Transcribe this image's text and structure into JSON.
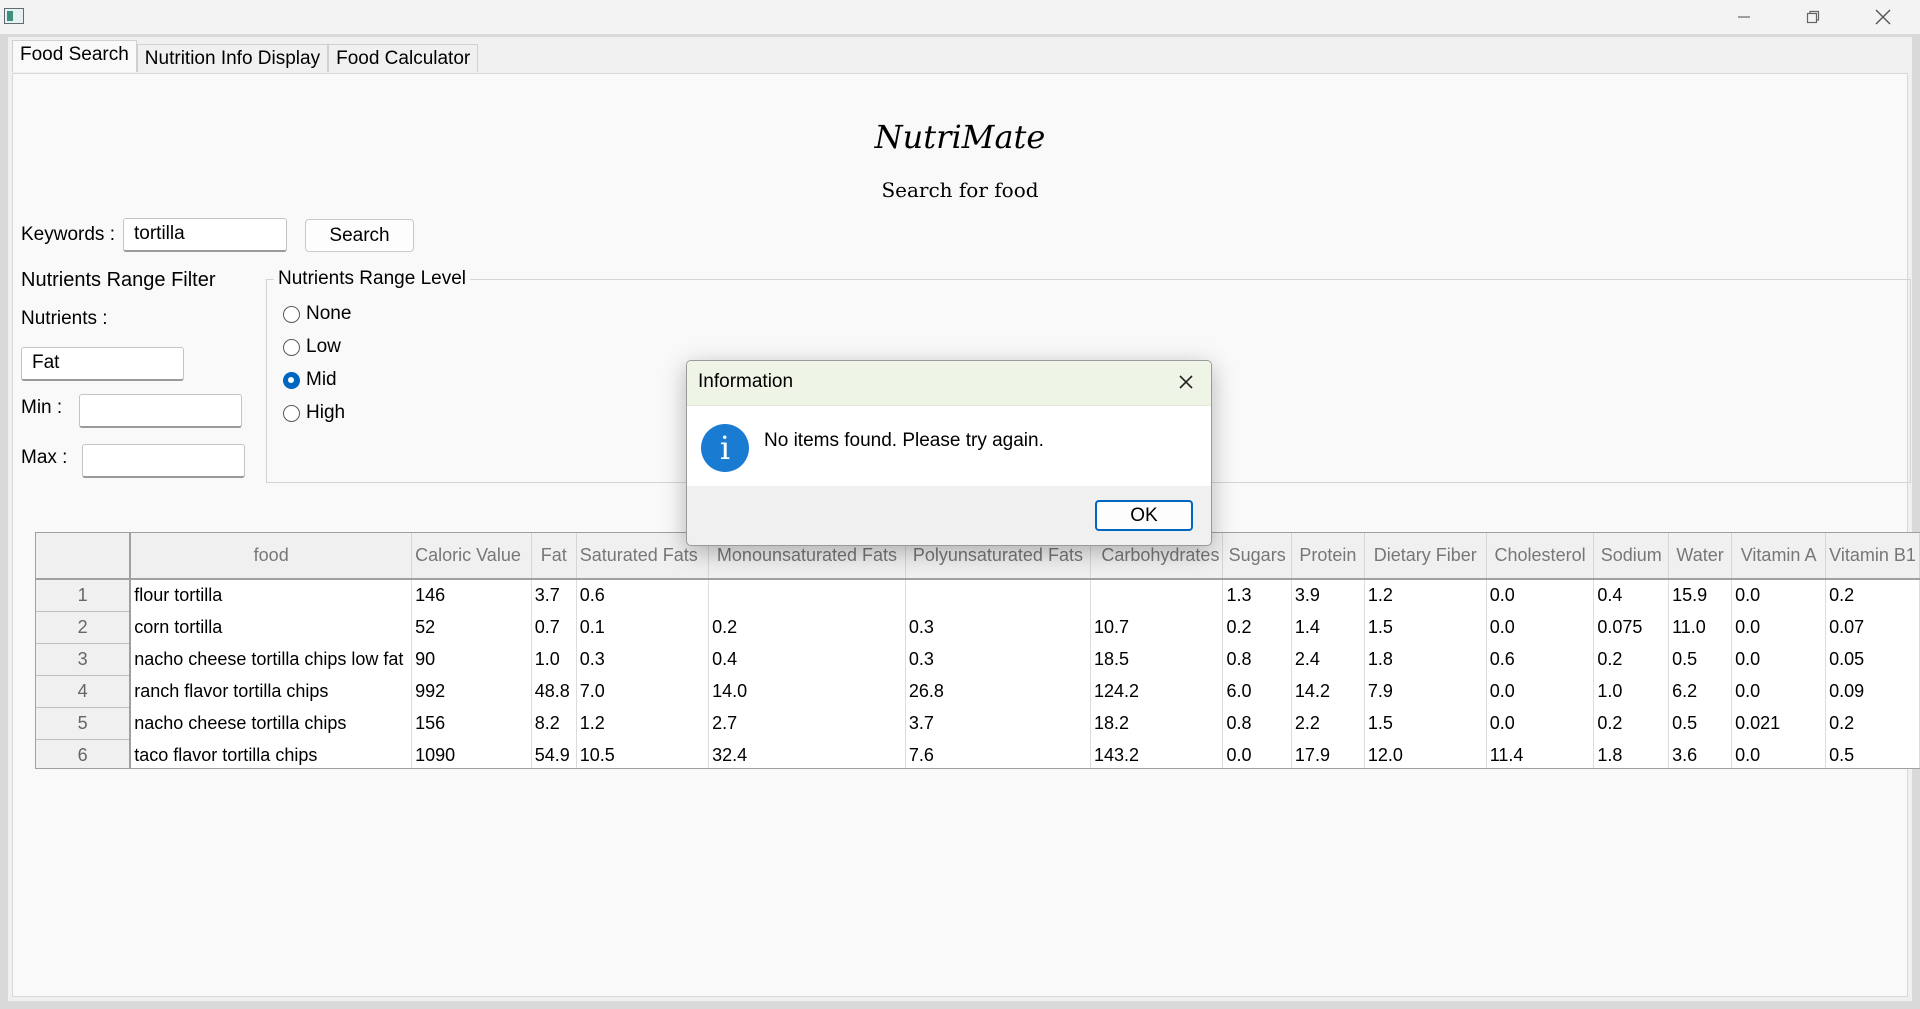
{
  "window": {
    "controls": [
      "minimize-icon",
      "restore-icon",
      "close-icon"
    ]
  },
  "tabs": [
    {
      "label": "Food Search",
      "active": true
    },
    {
      "label": "Nutrition Info Display",
      "active": false
    },
    {
      "label": "Food Calculator",
      "active": false
    }
  ],
  "header": {
    "title": "NutriMate",
    "subtitle": "Search for food"
  },
  "search": {
    "keywords_label": "Keywords :",
    "keywords_value": "tortilla",
    "button_label": "Search"
  },
  "filter": {
    "heading": "Nutrients Range Filter",
    "nutrients_label": "Nutrients :",
    "nutrients_value": "Fat",
    "min_label": "Min :",
    "min_value": "",
    "max_label": "Max :",
    "max_value": "",
    "level_title": "Nutrients Range Level",
    "levels": [
      {
        "label": "None",
        "selected": false
      },
      {
        "label": "Low",
        "selected": false
      },
      {
        "label": "Mid",
        "selected": true
      },
      {
        "label": "High",
        "selected": false
      }
    ]
  },
  "table": {
    "columns": [
      "food",
      "Caloric Value",
      "Fat",
      "Saturated Fats",
      "Monounsaturated Fats",
      "Polyunsaturated Fats",
      "Carbohydrates",
      "Sugars",
      "Protein",
      "Dietary Fiber",
      "Cholesterol",
      "Sodium",
      "Water",
      "Vitamin A",
      "Vitamin B1"
    ],
    "rows": [
      {
        "index": "1",
        "cells": [
          "flour tortilla",
          "146",
          "3.7",
          "0.6",
          "",
          "",
          "",
          "1.3",
          "3.9",
          "1.2",
          "0.0",
          "0.4",
          "15.9",
          "0.0",
          "0.2"
        ]
      },
      {
        "index": "2",
        "cells": [
          "corn tortilla",
          "52",
          "0.7",
          "0.1",
          "0.2",
          "0.3",
          "10.7",
          "0.2",
          "1.4",
          "1.5",
          "0.0",
          "0.075",
          "11.0",
          "0.0",
          "0.07"
        ]
      },
      {
        "index": "3",
        "cells": [
          "nacho cheese tortilla chips low fat",
          "90",
          "1.0",
          "0.3",
          "0.4",
          "0.3",
          "18.5",
          "0.8",
          "2.4",
          "1.8",
          "0.6",
          "0.2",
          "0.5",
          "0.0",
          "0.05"
        ]
      },
      {
        "index": "4",
        "cells": [
          "ranch flavor tortilla chips",
          "992",
          "48.8",
          "7.0",
          "14.0",
          "26.8",
          "124.2",
          "6.0",
          "14.2",
          "7.9",
          "0.0",
          "1.0",
          "6.2",
          "0.0",
          "0.09"
        ]
      },
      {
        "index": "5",
        "cells": [
          "nacho cheese tortilla chips",
          "156",
          "8.2",
          "1.2",
          "2.7",
          "3.7",
          "18.2",
          "0.8",
          "2.2",
          "1.5",
          "0.0",
          "0.2",
          "0.5",
          "0.021",
          "0.2"
        ]
      },
      {
        "index": "6",
        "cells": [
          "taco flavor tortilla chips",
          "1090",
          "54.9",
          "10.5",
          "32.4",
          "7.6",
          "143.2",
          "0.0",
          "17.9",
          "12.0",
          "11.4",
          "1.8",
          "3.6",
          "0.0",
          "0.5"
        ]
      }
    ]
  },
  "dialog": {
    "title": "Information",
    "message": "No items found. Please try again.",
    "ok_label": "OK",
    "icon": "info-icon"
  }
}
